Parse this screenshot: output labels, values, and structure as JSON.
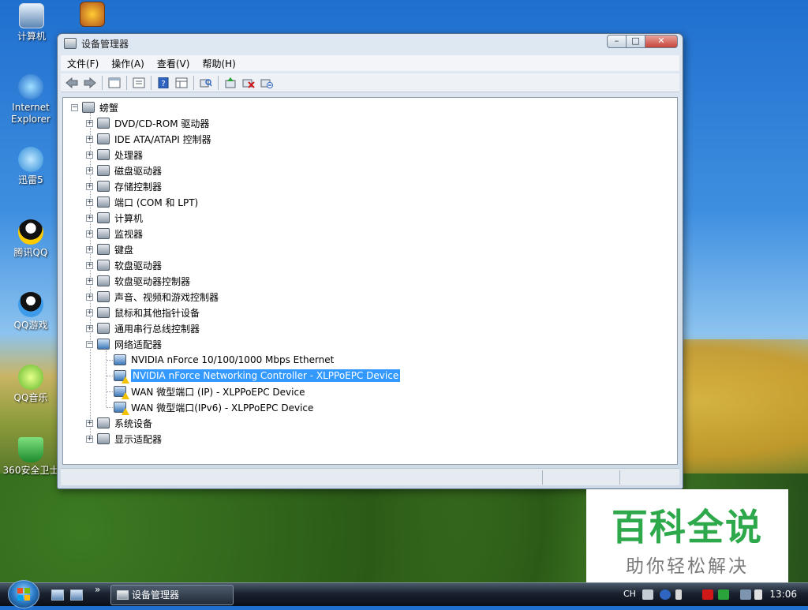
{
  "desktop": {
    "icons": [
      {
        "label": "计算机"
      },
      {
        "label": ""
      },
      {
        "label": "Internet Explorer"
      },
      {
        "label": "迅雷5"
      },
      {
        "label": "腾讯QQ"
      },
      {
        "label": "QQ游戏"
      },
      {
        "label": "QQ音乐"
      },
      {
        "label": "360安全卫士"
      }
    ]
  },
  "window": {
    "title": "设备管理器",
    "caption": {
      "minimize": "–",
      "maximize": "□",
      "close": "✕"
    },
    "menu": [
      "文件(F)",
      "操作(A)",
      "查看(V)",
      "帮助(H)"
    ],
    "toolbar_icons": [
      "back-icon",
      "forward-icon",
      "properties-window-icon",
      "console-tree-icon",
      "help-icon",
      "details-view-icon",
      "scan-hardware-icon",
      "update-driver-icon",
      "uninstall-icon",
      "disable-icon"
    ],
    "tree": {
      "root": "螃蟹",
      "categories": [
        {
          "label": "DVD/CD-ROM 驱动器",
          "expanded": false
        },
        {
          "label": "IDE ATA/ATAPI 控制器",
          "expanded": false
        },
        {
          "label": "处理器",
          "expanded": false
        },
        {
          "label": "磁盘驱动器",
          "expanded": false
        },
        {
          "label": "存储控制器",
          "expanded": false
        },
        {
          "label": "端口 (COM 和 LPT)",
          "expanded": false
        },
        {
          "label": "计算机",
          "expanded": false
        },
        {
          "label": "监视器",
          "expanded": false
        },
        {
          "label": "键盘",
          "expanded": false
        },
        {
          "label": "软盘驱动器",
          "expanded": false
        },
        {
          "label": "软盘驱动器控制器",
          "expanded": false
        },
        {
          "label": "声音、视频和游戏控制器",
          "expanded": false
        },
        {
          "label": "鼠标和其他指针设备",
          "expanded": false
        },
        {
          "label": "通用串行总线控制器",
          "expanded": false
        },
        {
          "label": "网络适配器",
          "expanded": true
        },
        {
          "label": "系统设备",
          "expanded": false
        },
        {
          "label": "显示适配器",
          "expanded": false
        }
      ],
      "network_children": [
        {
          "label": "NVIDIA nForce 10/100/1000 Mbps Ethernet",
          "warning": false,
          "selected": false
        },
        {
          "label": "NVIDIA nForce Networking Controller - XLPPoEPC Device",
          "warning": true,
          "selected": true
        },
        {
          "label": "WAN 微型端口 (IP) - XLPPoEPC Device",
          "warning": true,
          "selected": false
        },
        {
          "label": "WAN 微型端口(IPv6) - XLPPoEPC Device",
          "warning": true,
          "selected": false
        }
      ],
      "expand_glyph": "+",
      "collapse_glyph": "−"
    }
  },
  "watermark": {
    "title": "百科全说",
    "subtitle": "助你轻松解决"
  },
  "taskbar": {
    "more": "»",
    "task_button": "设备管理器",
    "tray": {
      "language": "CH"
    },
    "clock": "13:06"
  },
  "colors": {
    "selection": "#3399ff",
    "watermark_green": "#2da84a",
    "warning": "#f2c200"
  }
}
